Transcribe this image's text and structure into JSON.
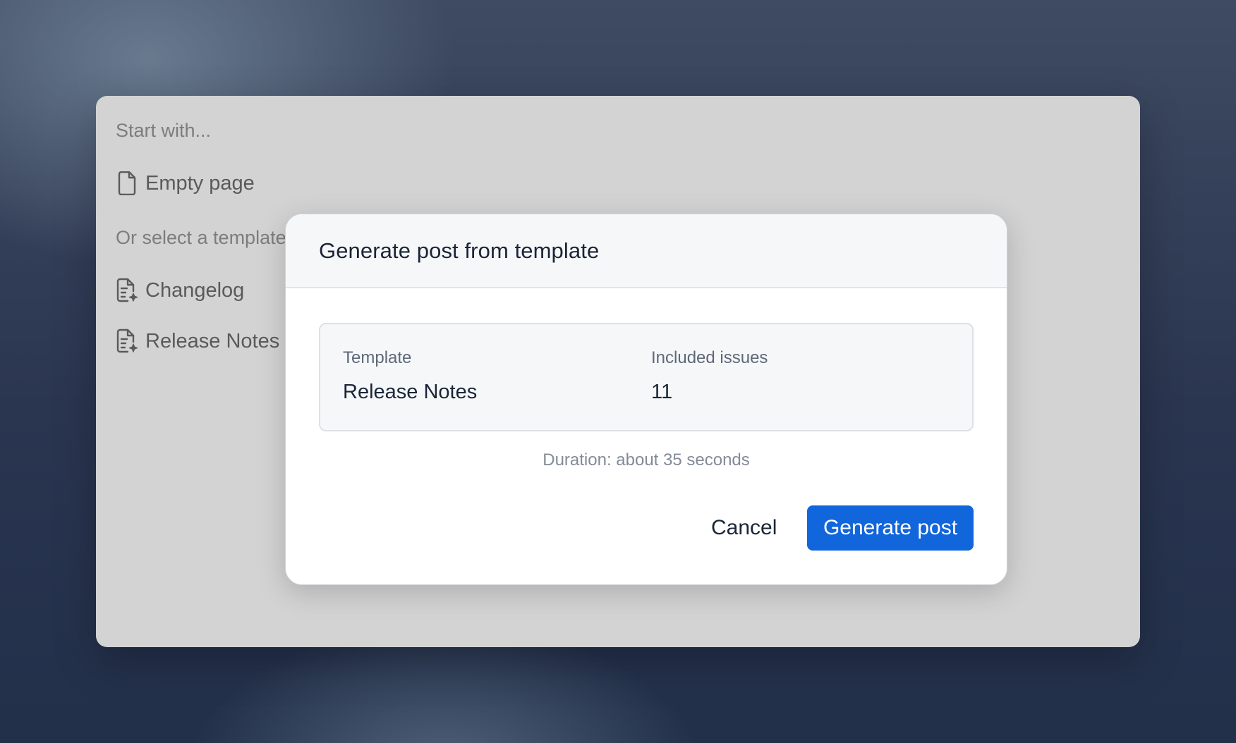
{
  "background_panel": {
    "start_heading": "Start with...",
    "empty_page_label": "Empty page",
    "template_heading": "Or select a template",
    "templates": [
      {
        "label": "Changelog",
        "icon": "document-sparkle-icon"
      },
      {
        "label": "Release Notes",
        "icon": "document-sparkle-icon"
      }
    ],
    "empty_page_icon": "document-icon"
  },
  "dialog": {
    "title": "Generate post from template",
    "template_label": "Template",
    "template_value": "Release Notes",
    "issues_label": "Included issues",
    "issues_value": "11",
    "duration_text": "Duration: about 35 seconds",
    "cancel_label": "Cancel",
    "generate_label": "Generate post"
  },
  "colors": {
    "primary_button": "#1266db",
    "overlay_panel": "#d3d3d3",
    "dialog_header": "#f6f7f9"
  }
}
